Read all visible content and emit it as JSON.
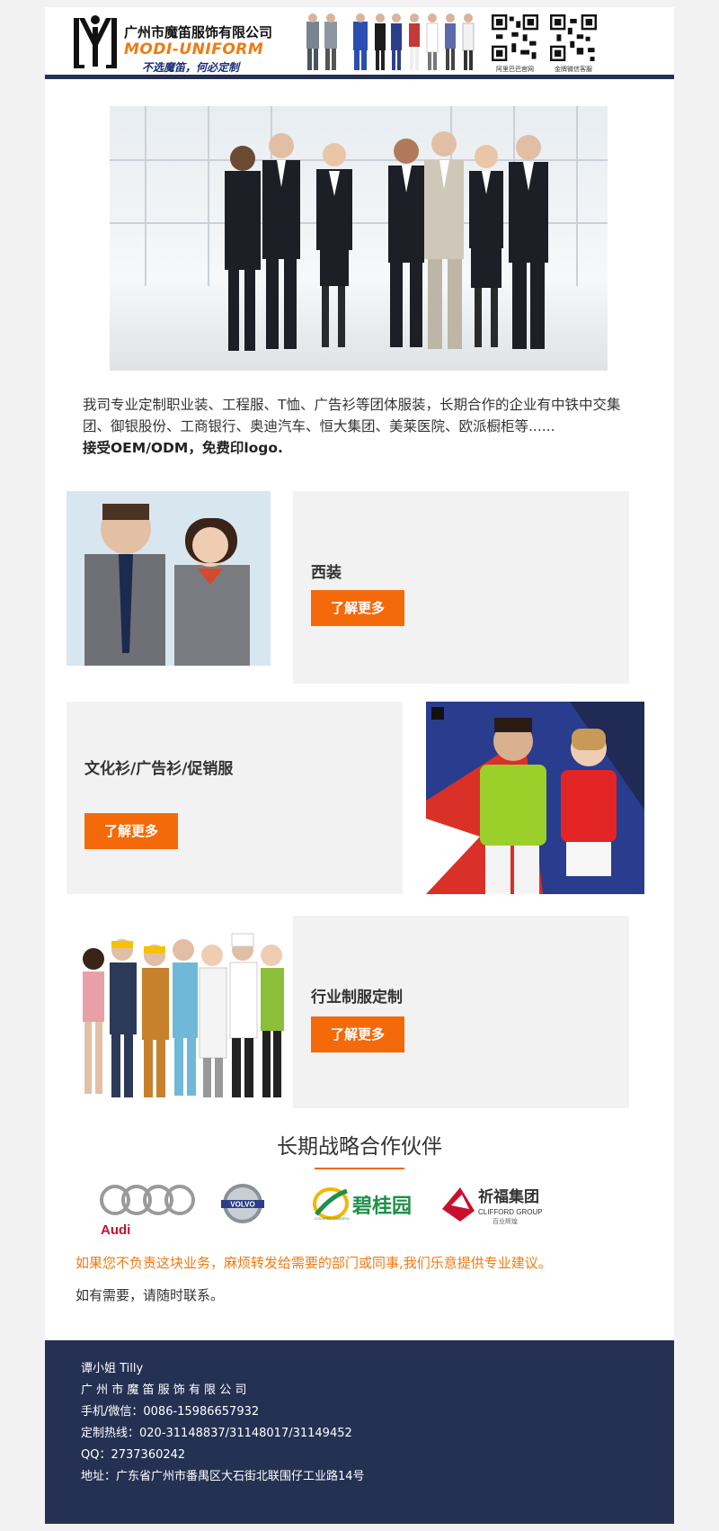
{
  "header": {
    "company_name": "广州市魔笛服饰有限公司",
    "company_en": "MODI-UNIFORM",
    "slogan": "不选魔笛，何必定制",
    "qr_codes": [
      {
        "caption": "阿里巴巴官网"
      },
      {
        "caption": "金牌微信客服"
      }
    ]
  },
  "intro": {
    "text": "我司专业定制职业装、工程服、T恤、广告衫等团体服装，长期合作的企业有中铁中交集团、御银股份、工商银行、奥迪汽车、恒大集团、美莱医院、欧派橱柜等......",
    "highlight": "接受OEM/ODM，免费印logo."
  },
  "products": [
    {
      "title": "西装",
      "button": "了解更多"
    },
    {
      "title": "文化衫/广告衫/促销服",
      "button": "了解更多"
    },
    {
      "title": "行业制服定制",
      "button": "了解更多"
    }
  ],
  "partners": {
    "title": "长期战略合作伙伴",
    "logos": [
      {
        "name": "Audi",
        "text": "Audi"
      },
      {
        "name": "Volvo",
        "text": "VOLVO"
      },
      {
        "name": "Country Garden",
        "text": "碧桂园",
        "sub": "COUNTRY GARDEN"
      },
      {
        "name": "Clifford Group",
        "text": "祈福集团",
        "sub": "CLIFFORD GROUP",
        "sub2": "百业辉煌"
      }
    ],
    "accent_color": "#f46a0a"
  },
  "notice": "如果您不负责这块业务，麻烦转发给需要的部门或同事,我们乐意提供专业建议。",
  "contact_note": "如有需要，请随时联系。",
  "footer": {
    "contact_name": "谭小姐 Tilly",
    "company": "广 州 市 魔 笛 服 饰 有 限 公 司",
    "mobile": "手机/微信：0086-15986657932",
    "hotline": "定制热线：020-31148837/31148017/31149452",
    "qq": "QQ：2737360242",
    "address": "地址：广东省广州市番禺区大石街北联围仔工业路14号"
  },
  "colors": {
    "navy": "#243152",
    "orange": "#f46a0a",
    "gray_card": "#f2f2f2"
  }
}
